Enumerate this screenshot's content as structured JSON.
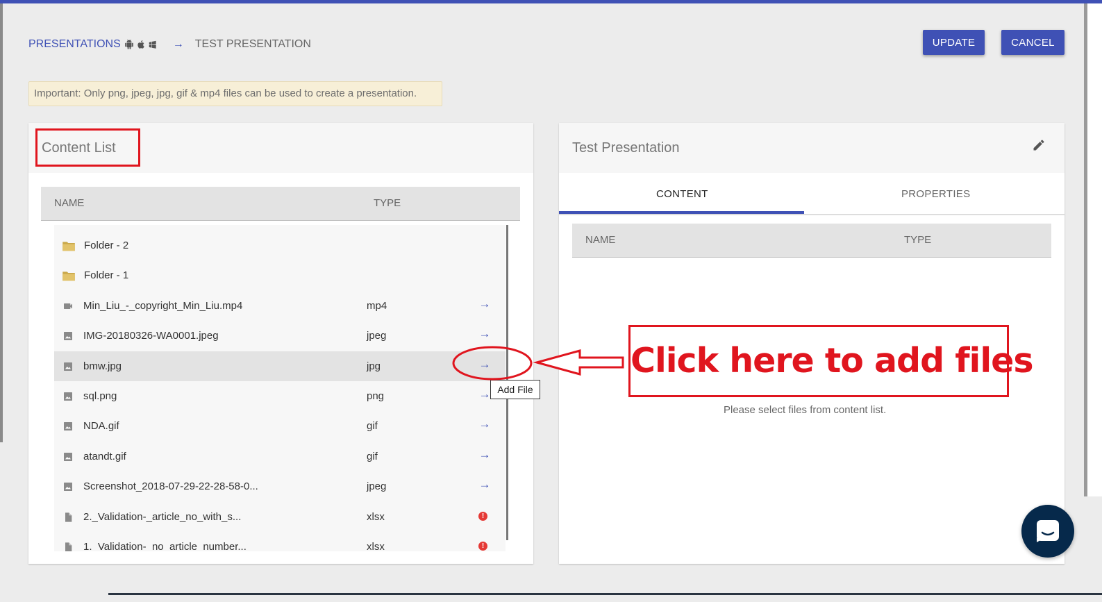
{
  "breadcrumb": {
    "root_label": "PRESENTATIONS",
    "os_icons": [
      "android-icon",
      "apple-icon",
      "windows-icon"
    ],
    "separator": "→",
    "current": "TEST PRESENTATION"
  },
  "actions": {
    "update_label": "UPDATE",
    "cancel_label": "CANCEL"
  },
  "notice": "Important: Only png, jpeg, jpg, gif & mp4 files can be used to create a presentation.",
  "content_list": {
    "title": "Content List",
    "columns": {
      "name": "NAME",
      "type": "TYPE"
    },
    "rows": [
      {
        "name": "Folder - 2",
        "type": "",
        "icon": "folder-icon",
        "action": ""
      },
      {
        "name": "Folder - 1",
        "type": "",
        "icon": "folder-icon",
        "action": ""
      },
      {
        "name": "Min_Liu_-_copyright_Min_Liu.mp4",
        "type": "mp4",
        "icon": "video-icon",
        "action": "add-arrow"
      },
      {
        "name": "IMG-20180326-WA0001.jpeg",
        "type": "jpeg",
        "icon": "image-icon",
        "action": "add-arrow"
      },
      {
        "name": "bmw.jpg",
        "type": "jpg",
        "icon": "image-icon",
        "action": "add-arrow",
        "selected": true
      },
      {
        "name": "sql.png",
        "type": "png",
        "icon": "image-icon",
        "action": "add-arrow"
      },
      {
        "name": "NDA.gif",
        "type": "gif",
        "icon": "image-icon",
        "action": "add-arrow"
      },
      {
        "name": "atandt.gif",
        "type": "gif",
        "icon": "image-icon",
        "action": "add-arrow"
      },
      {
        "name": "Screenshot_2018-07-29-22-28-58-0...",
        "type": "jpeg",
        "icon": "image-icon",
        "action": "add-arrow"
      },
      {
        "name": "2._Validation-_article_no_with_s...",
        "type": "xlsx",
        "icon": "document-icon",
        "action": "error"
      },
      {
        "name": "1._Validation-_no_article_number...",
        "type": "xlsx",
        "icon": "document-icon",
        "action": "error"
      }
    ],
    "arrow_glyph": "→",
    "error_glyph": "!",
    "tooltip": "Add File"
  },
  "presentation": {
    "title": "Test Presentation",
    "tabs": [
      "CONTENT",
      "PROPERTIES"
    ],
    "active_tab": "CONTENT",
    "columns": {
      "name": "NAME",
      "type": "TYPE"
    },
    "empty_message": "Please select files from content list."
  },
  "annotation": {
    "callout_text": "Click here to add files",
    "color": "#e0151e"
  },
  "colors": {
    "primary": "#3f51b5",
    "chat_button": "#06294b",
    "error": "#e53935"
  }
}
